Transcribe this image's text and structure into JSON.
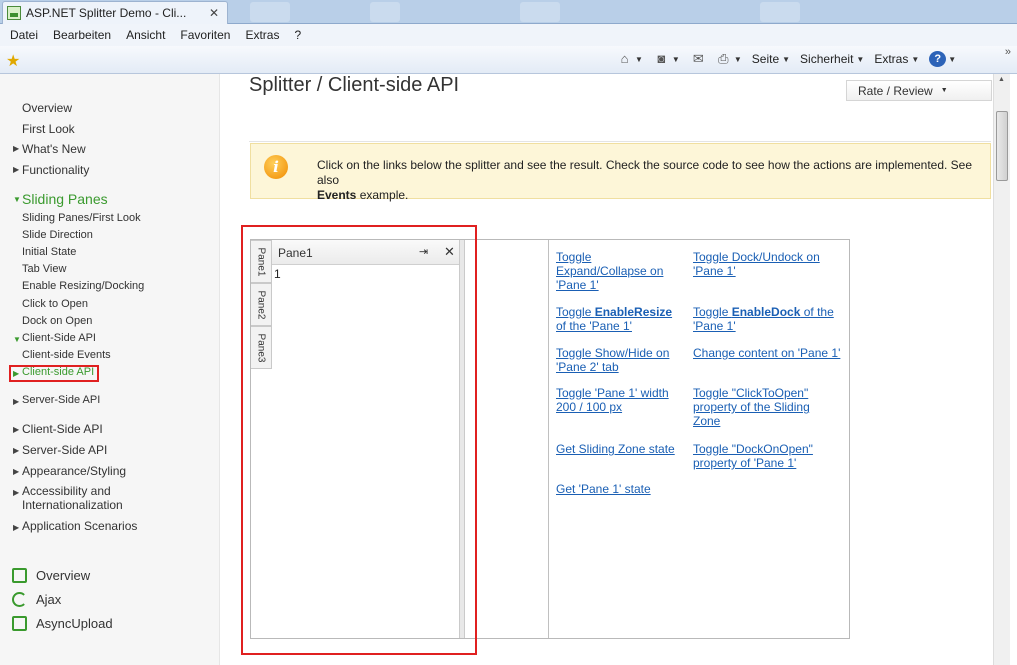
{
  "browser": {
    "tab_title": "ASP.NET Splitter Demo - Cli...",
    "tab_close": "✕",
    "menu": [
      "Datei",
      "Bearbeiten",
      "Ansicht",
      "Favoriten",
      "Extras",
      "?"
    ],
    "cmd": {
      "seite": "Seite",
      "sicherheit": "Sicherheit",
      "extras": "Extras",
      "more": "»"
    }
  },
  "sidebar": {
    "top_items": [
      "Overview",
      "First Look"
    ],
    "collapsed_items": [
      "What's New",
      "Functionality"
    ],
    "section_title": "Sliding Panes",
    "sub_items": [
      "Sliding Panes/First Look",
      "Slide Direction",
      "Initial State",
      "Tab View",
      "Enable Resizing/Docking",
      "Click to Open",
      "Dock on Open"
    ],
    "client_side_group": "Client-Side API",
    "client_side_children": [
      "Client-side Events",
      "Client-side API"
    ],
    "server_side_group": "Server-Side API",
    "bottom_groups": [
      "Client-Side API",
      "Server-Side API",
      "Appearance/Styling",
      "Accessibility and",
      "Internationalization",
      "Application Scenarios"
    ],
    "products": [
      "Overview",
      "Ajax",
      "AsyncUpload"
    ]
  },
  "page": {
    "title": "Splitter / Client-side API",
    "rate_label": "Rate / Review",
    "info_text_1": "Click on the links below the splitter and see the result. Check the source code to see how the actions are implemented. See also",
    "info_bold": "Events",
    "info_text_2": "example."
  },
  "splitter": {
    "tabs": [
      "Pane1",
      "Pane2",
      "Pane3"
    ],
    "pane_title": "Pane1",
    "pane_content": "1",
    "links_left": [
      [
        "Toggle",
        "Expand/Collapse on",
        "'Pane 1'"
      ],
      [
        "Toggle ",
        "EnableResize",
        "of the 'Pane 1'"
      ],
      [
        "Toggle Show/Hide on",
        "'Pane 2' tab"
      ],
      [
        "Toggle 'Pane 1' width",
        "200 / 100 px"
      ],
      [
        "Get Sliding Zone state"
      ],
      [
        "Get 'Pane 1' state"
      ]
    ],
    "links_right": [
      [
        "Toggle Dock/Undock on",
        "'Pane 1'"
      ],
      [
        "Toggle ",
        "EnableDock",
        " of the",
        "'Pane 1'"
      ],
      [
        "Change content on 'Pane 1'"
      ],
      [
        "Toggle \"ClickToOpen\"",
        "property of the Sliding",
        "Zone"
      ],
      [
        "Toggle \"DockOnOpen\"",
        "property of 'Pane 1'"
      ]
    ]
  },
  "colors": {
    "accent_green": "#3a9a2e",
    "highlight_red": "#e02020",
    "link_blue": "#1a5fb4",
    "info_bg": "#fdf6d8"
  }
}
